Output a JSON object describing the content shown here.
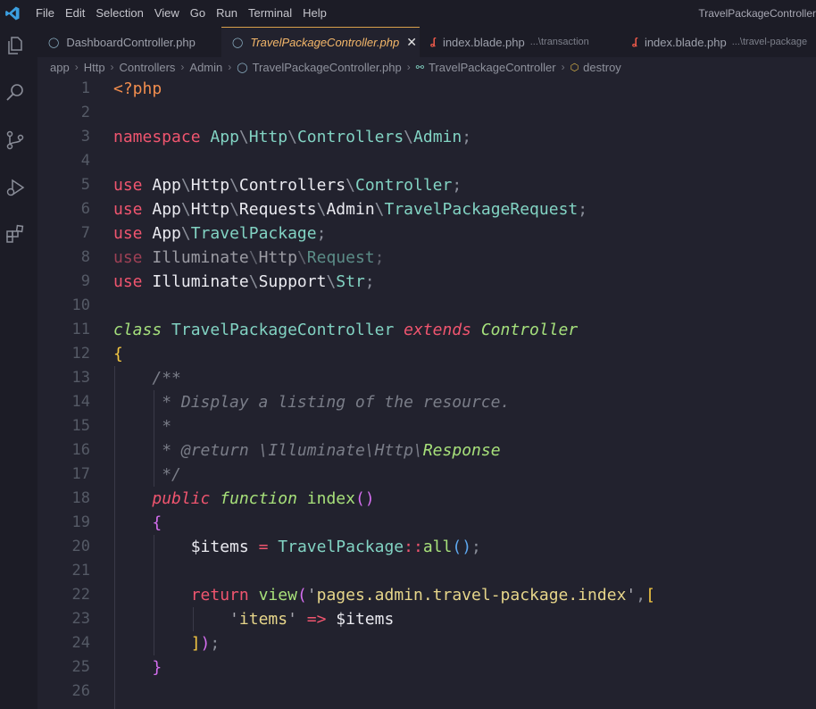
{
  "titlebar": {
    "menu": [
      "File",
      "Edit",
      "Selection",
      "View",
      "Go",
      "Run",
      "Terminal",
      "Help"
    ],
    "window_title": "TravelPackageController"
  },
  "tabs": [
    {
      "label": "DashboardController.php",
      "hint": "",
      "icon": "php-icon",
      "icon_glyph": "🐘",
      "active": false
    },
    {
      "label": "TravelPackageController.php",
      "hint": "",
      "icon": "php-icon",
      "icon_glyph": "🐘",
      "active": true
    },
    {
      "label": "index.blade.php",
      "hint": "...\\transaction",
      "icon": "laravel-icon",
      "icon_glyph": "ʆ",
      "active": false
    },
    {
      "label": "index.blade.php",
      "hint": "...\\travel-package",
      "icon": "laravel-icon",
      "icon_glyph": "ʆ",
      "active": false
    }
  ],
  "breadcrumb": {
    "items": [
      "app",
      "Http",
      "Controllers",
      "Admin",
      "TravelPackageController.php",
      "TravelPackageController",
      "destroy"
    ]
  },
  "editor": {
    "line_numbers": [
      "1",
      "2",
      "3",
      "4",
      "5",
      "6",
      "7",
      "8",
      "9",
      "10",
      "11",
      "12",
      "13",
      "14",
      "15",
      "16",
      "17",
      "18",
      "19",
      "20",
      "21",
      "22",
      "23",
      "24",
      "25",
      "26"
    ],
    "lines": [
      "<?php",
      "",
      "namespace App\\Http\\Controllers\\Admin;",
      "",
      "use App\\Http\\Controllers\\Controller;",
      "use App\\Http\\Requests\\Admin\\TravelPackageRequest;",
      "use App\\TravelPackage;",
      "use Illuminate\\Http\\Request;",
      "use Illuminate\\Support\\Str;",
      "",
      "class TravelPackageController extends Controller",
      "{",
      "    /**",
      "     * Display a listing of the resource.",
      "     *",
      "     * @return \\Illuminate\\Http\\Response",
      "     */",
      "    public function index()",
      "    {",
      "        $items = TravelPackage::all();",
      "",
      "        return view('pages.admin.travel-package.index',[",
      "            'items' => $items",
      "        ]);",
      "    }",
      ""
    ]
  },
  "colors": {
    "accent": "#d9a04a",
    "keyword": "#f0556f",
    "namespace": "#82d3c3",
    "string": "#e6d58a",
    "function": "#a7e07a"
  }
}
